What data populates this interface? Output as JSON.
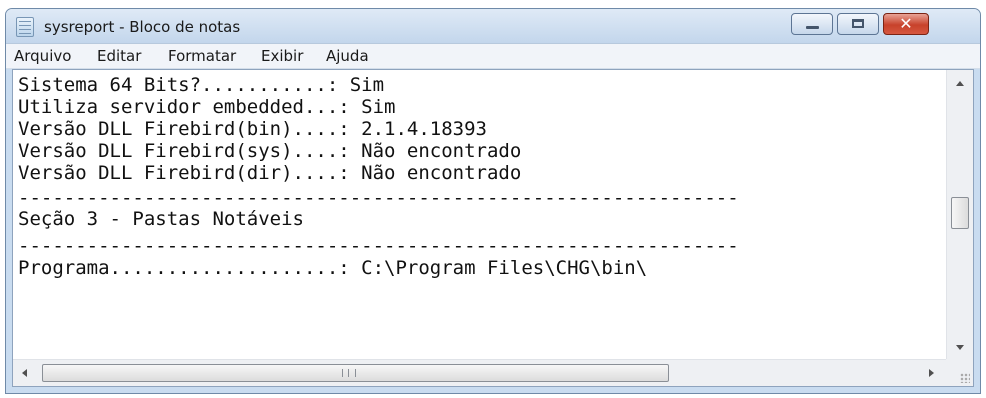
{
  "window": {
    "title": "sysreport - Bloco de notas"
  },
  "menu": {
    "items": [
      "Arquivo",
      "Editar",
      "Formatar",
      "Exibir",
      "Ajuda"
    ]
  },
  "document": {
    "lines": [
      "Sistema 64 Bits?...........: Sim",
      "Utiliza servidor embedded...: Sim",
      "Versão DLL Firebird(bin)....: 2.1.4.18393",
      "Versão DLL Firebird(sys)....: Não encontrado",
      "Versão DLL Firebird(dir)....: Não encontrado",
      "---------------------------------------------------------------",
      "Seção 3 - Pastas Notáveis",
      "---------------------------------------------------------------",
      "Programa....................: C:\\Program Files\\CHG\\bin\\"
    ]
  },
  "icons": {
    "app": "notepad-icon",
    "minimize": "minimize-icon",
    "maximize": "maximize-icon",
    "close": "close-icon",
    "scroll_up": "arrow-up-icon",
    "scroll_down": "arrow-down-icon",
    "scroll_left": "arrow-left-icon",
    "scroll_right": "arrow-right-icon",
    "resize": "resize-grip-icon"
  },
  "colors": {
    "titlebar": "#c3d6ec",
    "close_button": "#c7422b",
    "menubar": "#f1f4f9",
    "text": "#111111"
  }
}
